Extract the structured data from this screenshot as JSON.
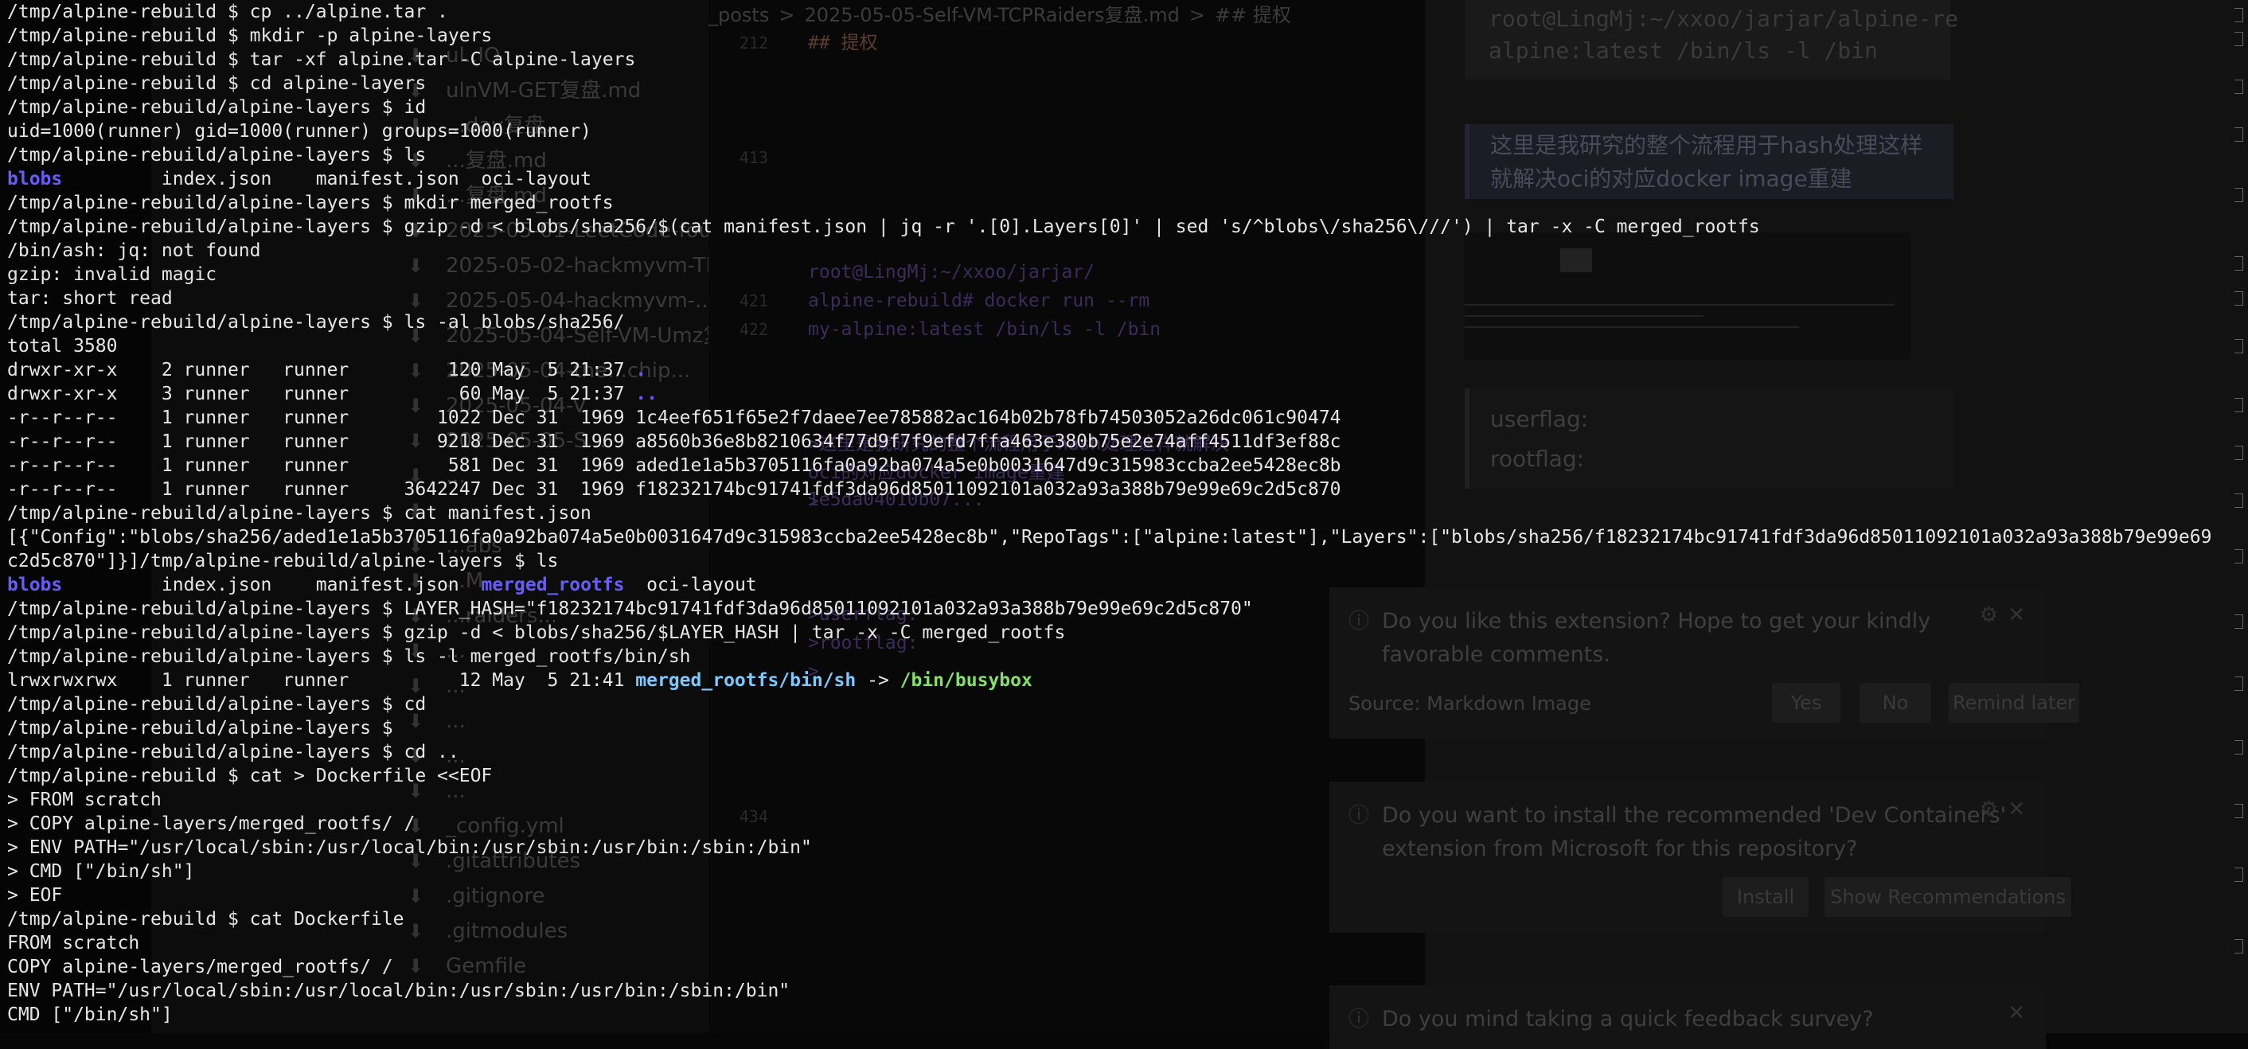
{
  "background": {
    "breadcrumb": [
      "_posts",
      ">",
      "2025-05-05-Self-VM-TCPRaiders复盘.md",
      ">",
      "## 提权"
    ],
    "sidebar_files": [
      {
        "icon": "file-icon",
        "name": "ul..IO"
      },
      {
        "icon": "file-icon",
        "name": "ulnVM-GET复盘.md"
      },
      {
        "icon": "file-icon",
        "name": "...day复盘..."
      },
      {
        "icon": "file-icon",
        "name": "...复盘.md"
      },
      {
        "icon": "file-icon",
        "name": "...复盘.md"
      },
      {
        "icon": "file-icon",
        "name": "2025-05-01-LeetCode-fourth-day复盘..."
      },
      {
        "icon": "file-icon",
        "name": "2025-05-02-hackmyvm-Thefinals复盘.md"
      },
      {
        "icon": "file-icon",
        "name": "2025-05-04-hackmyvm-...复盘.md"
      },
      {
        "icon": "file-icon",
        "name": "2025-05-04-Self-VM-Umz复盘.md"
      },
      {
        "icon": "file-icon",
        "name": "2025-05-04-the...chip..."
      },
      {
        "icon": "file-icon",
        "name": "2025-05-04-V..."
      },
      {
        "icon": "file-icon",
        "name": "2025-05-05-S..."
      },
      {
        "icon": "file-icon",
        "name": "..."
      },
      {
        "icon": "file-icon",
        "name": "..."
      },
      {
        "icon": "file-icon",
        "name": "...abs"
      },
      {
        "icon": "file-icon",
        "name": "...M"
      },
      {
        "icon": "file-icon",
        "name": "...raiders..."
      },
      {
        "icon": "file-icon",
        "name": "..."
      },
      {
        "icon": "file-icon",
        "name": "..."
      },
      {
        "icon": "file-icon",
        "name": "..."
      },
      {
        "icon": "file-icon",
        "name": "..."
      },
      {
        "icon": "file-icon",
        "name": "..."
      },
      {
        "icon": "file-icon",
        "name": "_config.yml"
      },
      {
        "icon": "file-icon",
        "name": ".gitattributes"
      },
      {
        "icon": "file-icon",
        "name": ".gitignore"
      },
      {
        "icon": "file-icon",
        "name": ".gitmodules"
      },
      {
        "icon": "file-icon",
        "name": "Gemfile"
      }
    ],
    "line_numbers": [
      "212",
      "",
      "",
      "",
      "413",
      "",
      "",
      "",
      "",
      "421",
      "422",
      "",
      "",
      "",
      "",
      "",
      "",
      "",
      "",
      "",
      "",
      "",
      "",
      "",
      "",
      "",
      "",
      "434"
    ],
    "code_lines": [
      {
        "text": "## 提权",
        "heading": true
      },
      {
        "text": ""
      },
      {
        "text": ""
      },
      {
        "text": ""
      },
      {
        "text": ""
      },
      {
        "text": ""
      },
      {
        "text": ""
      },
      {
        "text": ""
      },
      {
        "text": "root@LingMj:~/xxoo/jarjar/"
      },
      {
        "text": "alpine-rebuild# docker run --rm"
      },
      {
        "text": "my-alpine:latest /bin/ls -l /bin"
      },
      {
        "text": ""
      },
      {
        "text": ""
      },
      {
        "text": ""
      },
      {
        "text": ">这里是我研究的整个流程用于hash处理这样就解决"
      },
      {
        "text": "oci的对应docker image重建"
      },
      {
        "text": ">"
      }
    ],
    "code_lines_bottom": [
      {
        "text": "1e5da04010b07..."
      },
      {
        "text": ""
      },
      {
        "text": ""
      },
      {
        "text": ""
      },
      {
        "text": ">userflag:"
      },
      {
        "text": ">rootflag:"
      },
      {
        "text": ">"
      }
    ],
    "preview_code": [
      "root@LingMj:~/xxoo/jarjar/alpine-re",
      "alpine:latest /bin/ls -l /bin"
    ],
    "preview_quote": "这里是我研究的整个流程用于hash处理这样就解决oci的对应docker image重建",
    "preview_flags": [
      "userflag:",
      "rootflag:"
    ],
    "notifications": [
      {
        "message": "Do you like this extension? Hope to get your kindly favorable comments.",
        "source": "Source: Markdown Image",
        "buttons": [
          "Yes",
          "No",
          "Remind later"
        ]
      },
      {
        "message": "Do you want to install the recommended 'Dev Containers' extension from Microsoft for this repository?",
        "source": "",
        "buttons": [
          "Install",
          "Show Recommendations"
        ]
      },
      {
        "message": "Do you mind taking a quick feedback survey?",
        "source": "",
        "buttons": []
      }
    ]
  },
  "terminal": {
    "lines": [
      [
        {
          "t": "/tmp/alpine-rebuild $ cp ../alpine.tar ."
        }
      ],
      [
        {
          "t": "/tmp/alpine-rebuild $ mkdir -p alpine-layers"
        }
      ],
      [
        {
          "t": "/tmp/alpine-rebuild $ tar -xf alpine.tar -C alpine-layers"
        }
      ],
      [
        {
          "t": "/tmp/alpine-rebuild $ cd alpine-layers"
        }
      ],
      [
        {
          "t": "/tmp/alpine-rebuild/alpine-layers $ id"
        }
      ],
      [
        {
          "t": "uid=1000(runner) gid=1000(runner) groups=1000(runner)"
        }
      ],
      [
        {
          "t": "/tmp/alpine-rebuild/alpine-layers $ ls"
        }
      ],
      [
        {
          "t": "blobs",
          "c": "blue"
        },
        {
          "t": "         index.json    manifest.json  oci-layout"
        }
      ],
      [
        {
          "t": "/tmp/alpine-rebuild/alpine-layers $ mkdir merged_rootfs"
        }
      ],
      [
        {
          "t": "/tmp/alpine-rebuild/alpine-layers $ gzip -d < blobs/sha256/$(cat manifest.json | jq -r '.[0].Layers[0]' | sed 's/^blobs\\/sha256\\///') | tar -x -C merged_rootfs"
        }
      ],
      [
        {
          "t": "/bin/ash: jq: not found"
        }
      ],
      [
        {
          "t": "gzip: invalid magic"
        }
      ],
      [
        {
          "t": "tar: short read"
        }
      ],
      [
        {
          "t": "/tmp/alpine-rebuild/alpine-layers $ ls -al blobs/sha256/"
        }
      ],
      [
        {
          "t": "total 3580"
        }
      ],
      [
        {
          "t": "drwxr-xr-x    2 runner   runner         120 May  5 21:37 "
        },
        {
          "t": ".",
          "c": "blue"
        }
      ],
      [
        {
          "t": "drwxr-xr-x    3 runner   runner          60 May  5 21:37 "
        },
        {
          "t": "..",
          "c": "blue"
        }
      ],
      [
        {
          "t": "-r--r--r--    1 runner   runner        1022 Dec 31  1969 1c4eef651f65e2f7daee7ee785882ac164b02b78fb74503052a26dc061c90474"
        }
      ],
      [
        {
          "t": "-r--r--r--    1 runner   runner        9218 Dec 31  1969 a8560b36e8b8210634f77d9f7f9efd7ffa463e380b75e2e74aff4511df3ef88c"
        }
      ],
      [
        {
          "t": "-r--r--r--    1 runner   runner         581 Dec 31  1969 aded1e1a5b3705116fa0a92ba074a5e0b0031647d9c315983ccba2ee5428ec8b"
        }
      ],
      [
        {
          "t": "-r--r--r--    1 runner   runner     3642247 Dec 31  1969 f18232174bc91741fdf3da96d85011092101a032a93a388b79e99e69c2d5c870"
        }
      ],
      [
        {
          "t": "/tmp/alpine-rebuild/alpine-layers $ cat manifest.json"
        }
      ],
      [
        {
          "t": "[{\"Config\":\"blobs/sha256/aded1e1a5b3705116fa0a92ba074a5e0b0031647d9c315983ccba2ee5428ec8b\",\"RepoTags\":[\"alpine:latest\"],\"Layers\":[\"blobs/sha256/f18232174bc91741fdf3da96d85011092101a032a93a388b79e99e69"
        }
      ],
      [
        {
          "t": "c2d5c870\"]}]/tmp/alpine-rebuild/alpine-layers $ ls"
        }
      ],
      [
        {
          "t": "blobs",
          "c": "blue"
        },
        {
          "t": "         index.json    manifest.json  "
        },
        {
          "t": "merged_rootfs",
          "c": "blue"
        },
        {
          "t": "  oci-layout"
        }
      ],
      [
        {
          "t": "/tmp/alpine-rebuild/alpine-layers $ LAYER_HASH=\"f18232174bc91741fdf3da96d85011092101a032a93a388b79e99e69c2d5c870\""
        }
      ],
      [
        {
          "t": "/tmp/alpine-rebuild/alpine-layers $ gzip -d < blobs/sha256/$LAYER_HASH | tar -x -C merged_rootfs"
        }
      ],
      [
        {
          "t": "/tmp/alpine-rebuild/alpine-layers $ ls -l merged_rootfs/bin/sh"
        }
      ],
      [
        {
          "t": "lrwxrwxrwx    1 runner   runner          12 May  5 21:41 "
        },
        {
          "t": "merged_rootfs/bin/sh",
          "c": "teal"
        },
        {
          "t": " -> "
        },
        {
          "t": "/bin/busybox",
          "c": "green"
        }
      ],
      [
        {
          "t": "/tmp/alpine-rebuild/alpine-layers $ cd"
        }
      ],
      [
        {
          "t": "/tmp/alpine-rebuild/alpine-layers $"
        }
      ],
      [
        {
          "t": "/tmp/alpine-rebuild/alpine-layers $ cd .."
        }
      ],
      [
        {
          "t": "/tmp/alpine-rebuild $ cat > Dockerfile <<EOF"
        }
      ],
      [
        {
          "t": "> FROM scratch"
        }
      ],
      [
        {
          "t": "> COPY alpine-layers/merged_rootfs/ /"
        }
      ],
      [
        {
          "t": "> ENV PATH=\"/usr/local/sbin:/usr/local/bin:/usr/sbin:/usr/bin:/sbin:/bin\""
        }
      ],
      [
        {
          "t": "> CMD [\"/bin/sh\"]"
        }
      ],
      [
        {
          "t": "> EOF"
        }
      ],
      [
        {
          "t": "/tmp/alpine-rebuild $ cat Dockerfile"
        }
      ],
      [
        {
          "t": "FROM scratch"
        }
      ],
      [
        {
          "t": "COPY alpine-layers/merged_rootfs/ /"
        }
      ],
      [
        {
          "t": "ENV PATH=\"/usr/local/sbin:/usr/local/bin:/usr/sbin:/usr/bin:/sbin:/bin\""
        }
      ],
      [
        {
          "t": "CMD [\"/bin/sh\"]"
        }
      ]
    ]
  },
  "colors": {
    "terminal_bg": "#070707",
    "terminal_fg": "#e6e6e6",
    "dir_blue": "#6a5bff",
    "symlink_teal": "#7cc8ff",
    "exec_green": "#84e06a"
  }
}
